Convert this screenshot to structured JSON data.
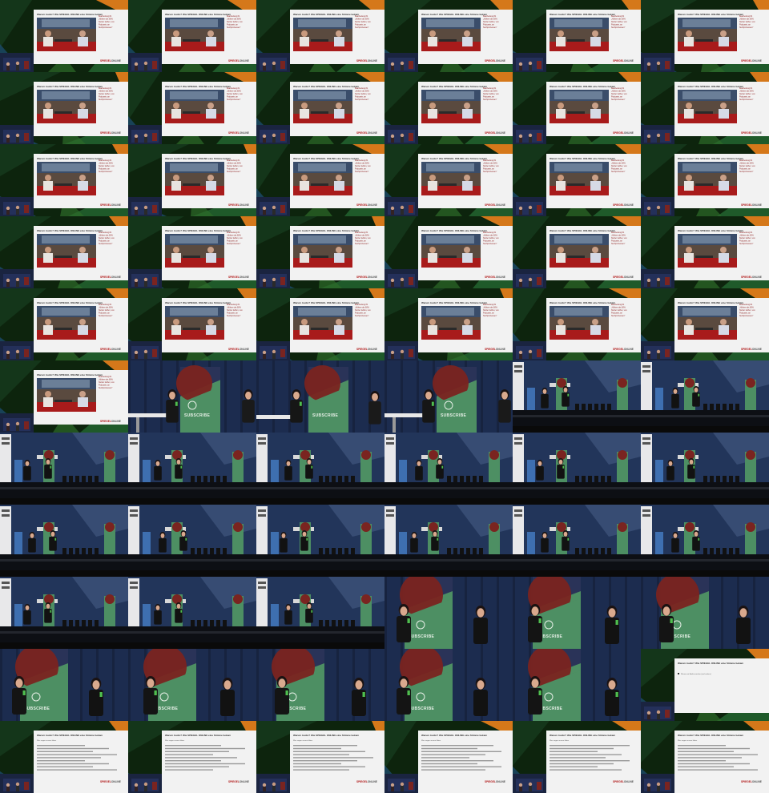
{
  "grid": {
    "columns": 6,
    "rows": 11
  },
  "slide": {
    "title": "Warum Audio? Wie SPIEGEL ONLINE eine Stimme bekam",
    "side_lines": [
      "Bearbeitung #1",
      "„Höhere als 60%",
      "Nutzer treffen, von",
      "Podcasts, an",
      "Suchprozessen\""
    ],
    "logo_main": "SPIEGEL",
    "logo_sub": "ONLINE"
  },
  "stage": {
    "subscribe_label": "SUBSCRIBE"
  },
  "checkbox_slide": {
    "title": "Warum Audio? Wie SPIEGEL ONLINE eine Stimme bekam",
    "item": "Warum wir Audio machen (mal anders)"
  },
  "text_slide": {
    "title": "Warum Audio? Wie SPIEGEL ONLINE eine Stimme bekam",
    "subtitle": "Was sagen unsere Hörer",
    "logo_main": "SPIEGEL",
    "logo_sub": "ONLINE"
  },
  "colors": {
    "green_bg": "#0d240d",
    "orange_accent": "#d5781a",
    "stage_blue": "#1c2c4f",
    "banner_green": "#4d8f63",
    "banner_red": "#7a2420",
    "slide_bg": "#f2f2f2"
  },
  "tiles": [
    "slide",
    "slide",
    "slide",
    "slide",
    "slide",
    "slide",
    "slide",
    "slide",
    "slide",
    "slide",
    "slide",
    "slide",
    "slide",
    "slide",
    "slide",
    "slide",
    "slide",
    "slide",
    "slide",
    "slide",
    "slide",
    "slide",
    "slide",
    "slide",
    "slide",
    "slide",
    "slide",
    "slide",
    "slide",
    "slide",
    "slide",
    "stage-close-left",
    "stage-close-pair",
    "stage-close-left",
    "stage-wide",
    "stage-wide",
    "stage-wide",
    "stage-wide",
    "stage-wide",
    "stage-wide",
    "stage-wide",
    "stage-wide",
    "stage-wide",
    "stage-wide",
    "stage-wide",
    "stage-wide",
    "stage-wide",
    "stage-wide",
    "stage-wide",
    "stage-wide",
    "stage-wide",
    "stage-close",
    "stage-close",
    "stage-close",
    "stage-close",
    "stage-close",
    "stage-close",
    "stage-close",
    "stage-close",
    "checkbox-slide",
    "text-slide",
    "text-slide",
    "text-slide",
    "text-slide",
    "text-slide",
    "text-slide"
  ]
}
